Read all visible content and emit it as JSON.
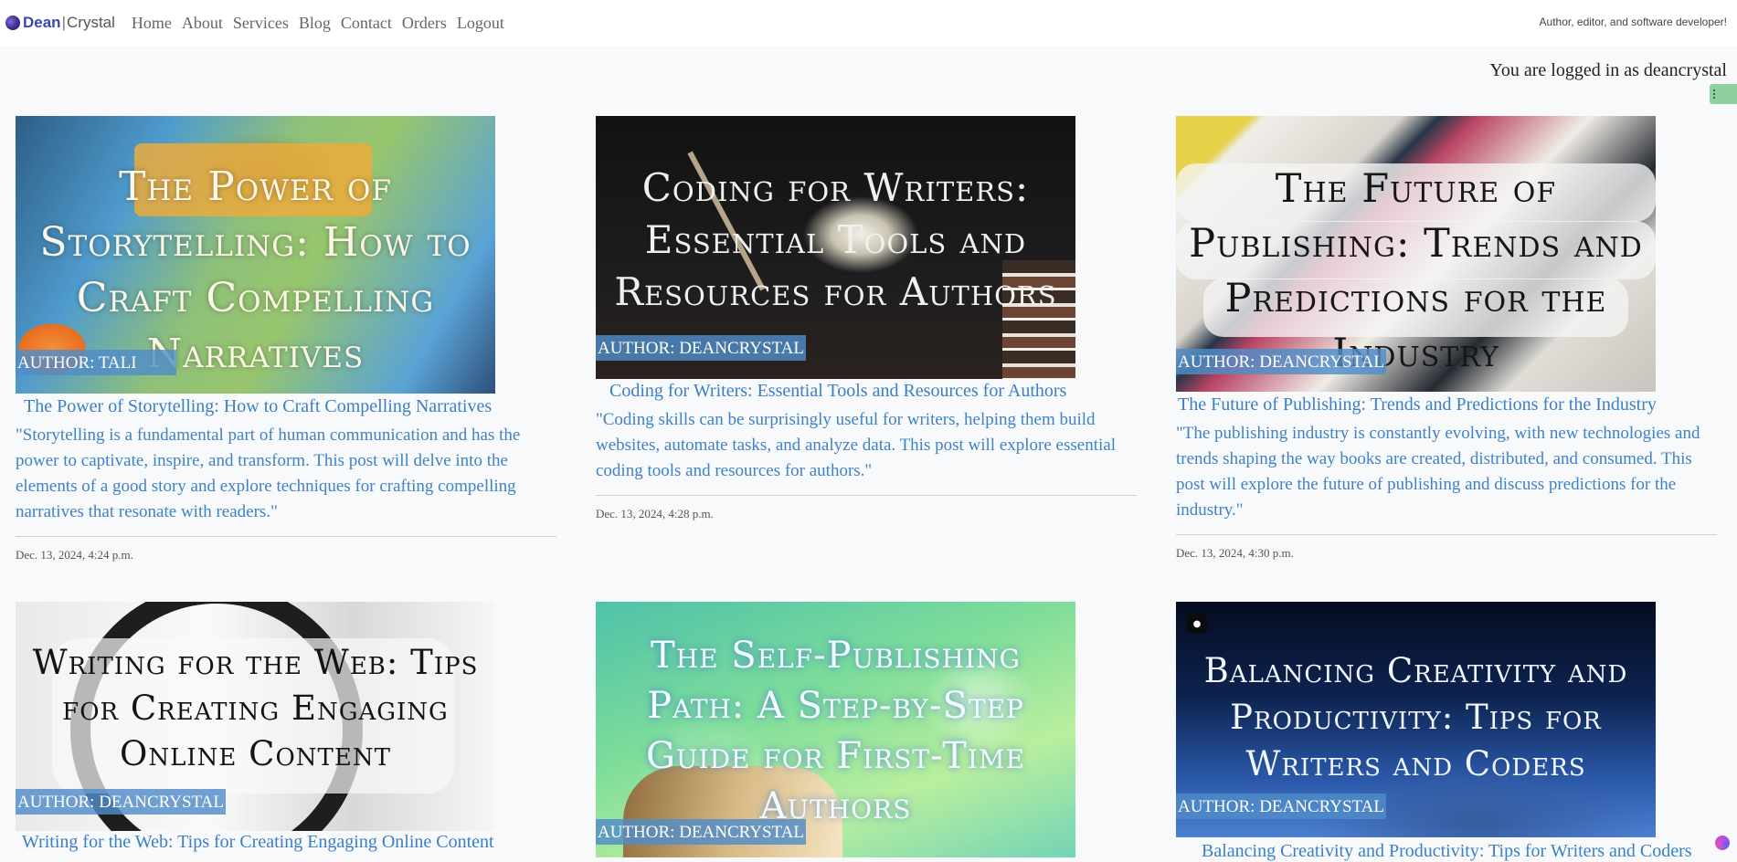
{
  "brand": {
    "name_bold": "Dean",
    "separator": "|",
    "name_light": "Crystal",
    "logo_icon": "crescent-moon-logo"
  },
  "nav": {
    "items": [
      "Home",
      "About",
      "Services",
      "Blog",
      "Contact",
      "Orders",
      "Logout"
    ]
  },
  "tagline": "Author, editor, and software developer!",
  "login_status": "You are logged in as deancrystal",
  "posts": [
    {
      "thumb_title": "The Power of Storytelling: How to Craft Compelling Narratives",
      "author": "AUTHOR: TALI",
      "title": "The Power of Storytelling: How to Craft Compelling Narratives",
      "excerpt": "\"Storytelling is a fundamental part of human communication and has the power to captivate, inspire, and transform. This post will delve into the elements of a good story and explore techniques for crafting compelling narratives that resonate with readers.\"",
      "date": "Dec. 13, 2024, 4:24 p.m."
    },
    {
      "thumb_title": "Coding for Writers: Essential Tools and Resources for Authors",
      "author": "AUTHOR: DEANCRYSTAL",
      "title": "Coding for Writers: Essential Tools and Resources for Authors",
      "excerpt": "\"Coding skills can be surprisingly useful for writers, helping them build websites, automate tasks, and analyze data. This post will explore essential coding tools and resources for authors.\"",
      "date": "Dec. 13, 2024, 4:28 p.m."
    },
    {
      "thumb_title": "The Future of Publishing: Trends and Predictions for the Industry",
      "author": "AUTHOR: DEANCRYSTAL",
      "title": "The Future of Publishing: Trends and Predictions for the Industry",
      "excerpt": "\"The publishing industry is constantly evolving, with new technologies and trends shaping the way books are created, distributed, and consumed. This post will explore the future of publishing and discuss predictions for the industry.\"",
      "date": "Dec. 13, 2024, 4:30 p.m."
    },
    {
      "thumb_title": "Writing for the Web: Tips for Creating Engaging Online Content",
      "author": "AUTHOR: DEANCRYSTAL",
      "title": "Writing for the Web: Tips for Creating Engaging Online Content"
    },
    {
      "thumb_title": "The Self-Publishing Path: A Step-by-Step Guide for First-Time Authors",
      "author": "AUTHOR: DEANCRYSTAL"
    },
    {
      "thumb_title": "Balancing Creativity and Productivity: Tips for Writers and Coders",
      "author": "AUTHOR: DEANCRYSTAL",
      "title": "Balancing Creativity and Productivity: Tips for Writers and Coders"
    }
  ],
  "colors": {
    "link": "#3b7fc4",
    "author_badge": "#508cc8",
    "brand": "#3b46b5"
  }
}
